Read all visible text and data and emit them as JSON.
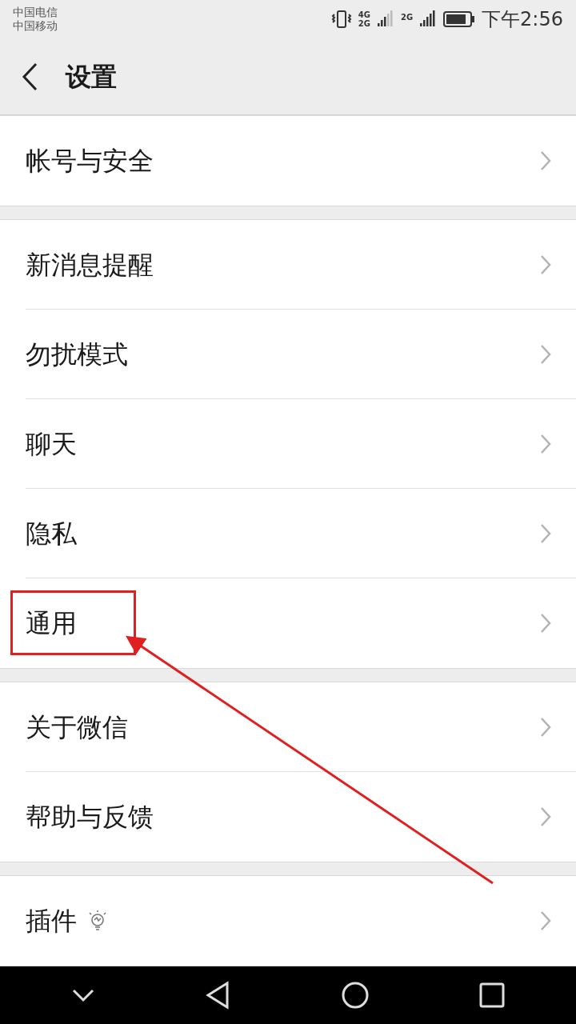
{
  "status_bar": {
    "carriers": [
      "中国电信",
      "中国移动"
    ],
    "sim1_network": [
      "4G",
      "2G"
    ],
    "sim2_network": "2G",
    "time": "下午2:56"
  },
  "header": {
    "title": "设置"
  },
  "groups": [
    {
      "items": [
        {
          "label": "帐号与安全",
          "kind": "plain"
        }
      ]
    },
    {
      "items": [
        {
          "label": "新消息提醒",
          "kind": "plain"
        },
        {
          "label": "勿扰模式",
          "kind": "plain"
        },
        {
          "label": "聊天",
          "kind": "plain"
        },
        {
          "label": "隐私",
          "kind": "plain"
        },
        {
          "label": "通用",
          "kind": "plain"
        }
      ]
    },
    {
      "items": [
        {
          "label": "关于微信",
          "kind": "plain"
        },
        {
          "label": "帮助与反馈",
          "kind": "plain"
        }
      ]
    },
    {
      "items": [
        {
          "label": "插件",
          "kind": "hint"
        }
      ]
    }
  ]
}
